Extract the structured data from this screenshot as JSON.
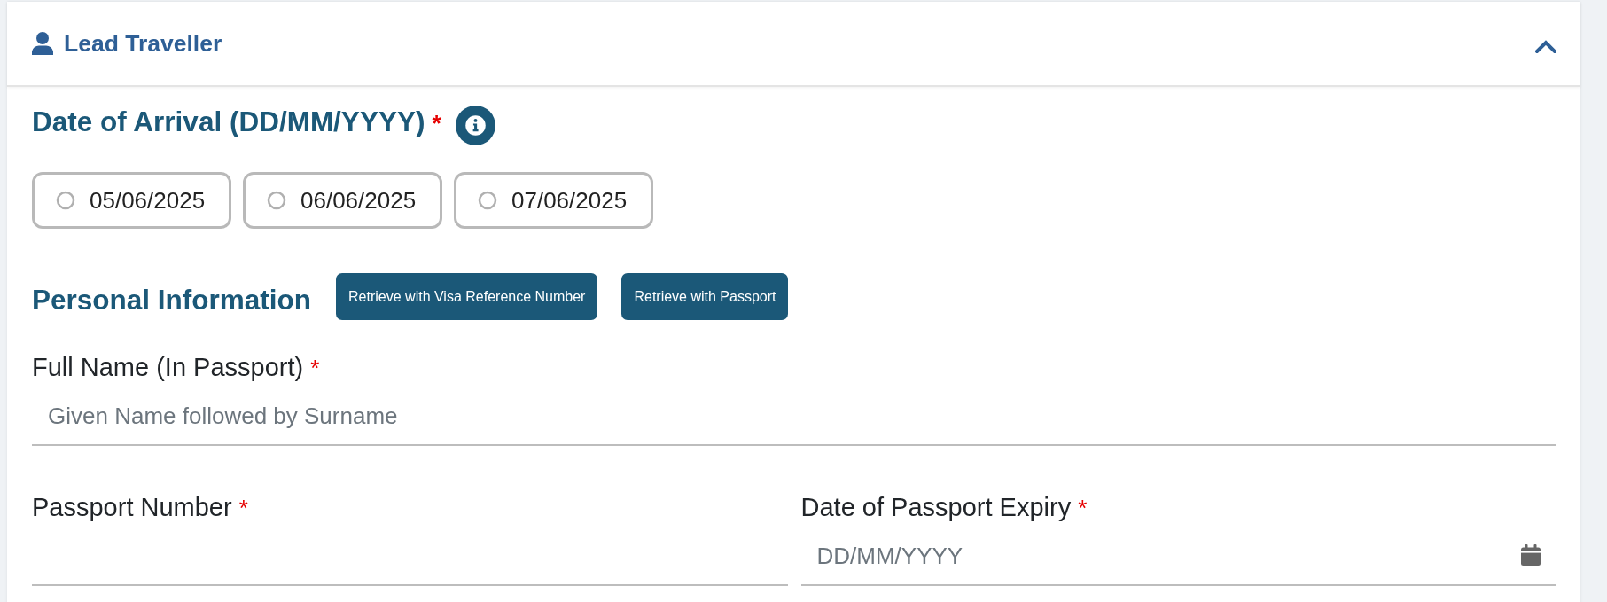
{
  "panel": {
    "title": "Lead Traveller",
    "expanded": true
  },
  "arrival": {
    "label": "Date of Arrival (DD/MM/YYYY)",
    "required_mark": "*",
    "options": [
      {
        "label": "05/06/2025",
        "selected": false
      },
      {
        "label": "06/06/2025",
        "selected": false
      },
      {
        "label": "07/06/2025",
        "selected": false
      }
    ]
  },
  "personal": {
    "heading": "Personal Information",
    "buttons": [
      "Retrieve with Visa Reference Number",
      "Retrieve with Passport"
    ]
  },
  "field_rows": [
    [
      {
        "kind": "text",
        "label": "Full Name (In Passport)",
        "required_mark": "*",
        "placeholder": "Given Name followed by Surname"
      }
    ],
    [
      {
        "kind": "text",
        "label": "Passport Number",
        "required_mark": "*"
      },
      {
        "kind": "date",
        "label": "Date of Passport Expiry",
        "required_mark": "*",
        "placeholder": "DD/MM/YYYY"
      }
    ]
  ]
}
